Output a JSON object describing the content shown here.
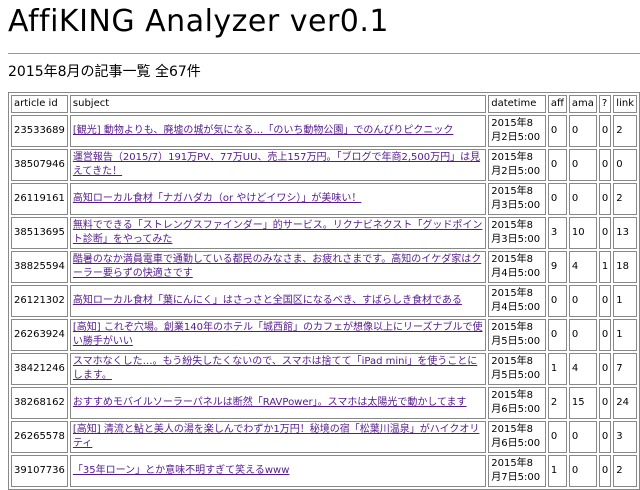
{
  "page": {
    "title": "AffiKING Analyzer ver0.1",
    "summary": "2015年8月の記事一覧 全67件"
  },
  "table": {
    "headers": [
      "article id",
      "subject",
      "datetime",
      "aff",
      "ama",
      "?",
      "link"
    ],
    "rows": [
      {
        "id": "23533689",
        "subject": "[観光] 動物よりも、廃墟の城が気になる…「のいち動物公園」でのんびりピクニック",
        "datetime": "2015年8月2日5:00",
        "aff": "0",
        "ama": "0",
        "q": "0",
        "link": "2"
      },
      {
        "id": "38507946",
        "subject": "運営報告（2015/7）191万PV、77万UU、売上157万円。「ブログで年商2,500万円」は見えてきた！",
        "datetime": "2015年8月2日5:00",
        "aff": "0",
        "ama": "0",
        "q": "0",
        "link": "0"
      },
      {
        "id": "26119161",
        "subject": "高知ローカル食材「ナガハダカ（or やけどイワシ）」が美味い！",
        "datetime": "2015年8月3日5:00",
        "aff": "0",
        "ama": "0",
        "q": "0",
        "link": "2"
      },
      {
        "id": "38513695",
        "subject": "無料でできる「ストレングスファインダー」的サービス。リクナビネクスト「グッドポイント診断」をやってみた",
        "datetime": "2015年8月3日5:00",
        "aff": "3",
        "ama": "10",
        "q": "0",
        "link": "13"
      },
      {
        "id": "38825594",
        "subject": "酷暑のなか満員電車で通勤している都民のみなさま、お疲れさまです。高知のイケダ家はクーラー要らずの快適さです",
        "datetime": "2015年8月4日5:00",
        "aff": "9",
        "ama": "4",
        "q": "1",
        "link": "18"
      },
      {
        "id": "26121302",
        "subject": "高知ローカル食材「葉にんにく」はさっさと全国区になるべき、すばらしき食材である",
        "datetime": "2015年8月4日5:00",
        "aff": "0",
        "ama": "0",
        "q": "0",
        "link": "1"
      },
      {
        "id": "26263924",
        "subject": "[高知] これぞ穴場。創業140年のホテル「城西館」のカフェが想像以上にリーズナブルで使い勝手がいい",
        "datetime": "2015年8月5日5:00",
        "aff": "0",
        "ama": "0",
        "q": "0",
        "link": "1"
      },
      {
        "id": "38421246",
        "subject": "スマホなくした…。もう紛失したくないので、スマホは捨てて「iPad mini」を使うことにします。",
        "datetime": "2015年8月5日5:00",
        "aff": "1",
        "ama": "4",
        "q": "0",
        "link": "7"
      },
      {
        "id": "38268162",
        "subject": "おすすめモバイルソーラーパネルは断然「RAVPower」。スマホは太陽光で動かしてます",
        "datetime": "2015年8月6日5:00",
        "aff": "2",
        "ama": "15",
        "q": "0",
        "link": "24"
      },
      {
        "id": "26265578",
        "subject": "[高知] 清流と鮎と美人の湯を楽しんでわずか1万円！秘境の宿「松葉川温泉」がハイクオリティ",
        "datetime": "2015年8月6日5:00",
        "aff": "0",
        "ama": "0",
        "q": "0",
        "link": "3"
      },
      {
        "id": "39107736",
        "subject": "「35年ローン」とか意味不明すぎて笑えるwww",
        "datetime": "2015年8月7日5:00",
        "aff": "1",
        "ama": "0",
        "q": "0",
        "link": "2"
      }
    ]
  }
}
